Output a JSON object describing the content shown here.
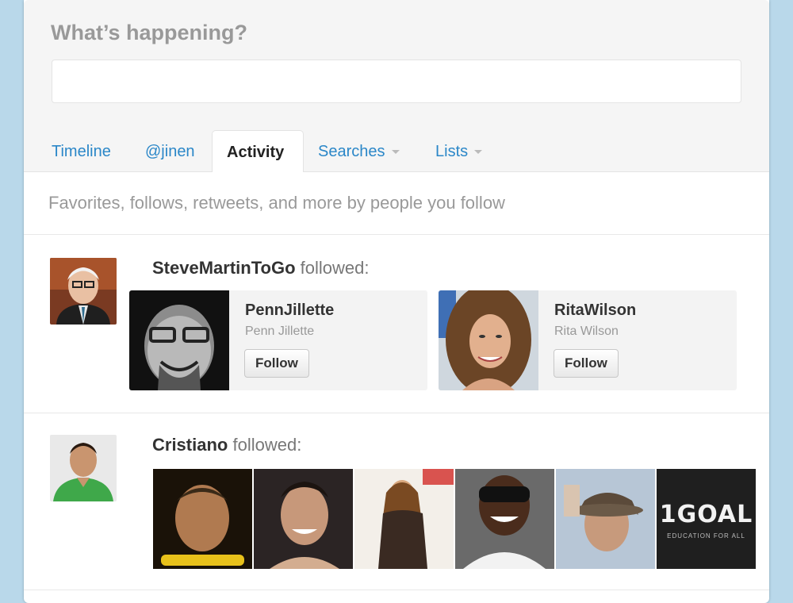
{
  "compose": {
    "title": "What’s happening?",
    "input_value": ""
  },
  "tabs": [
    {
      "label": "Timeline",
      "active": false
    },
    {
      "label": "@jinen",
      "active": false
    },
    {
      "label": "Activity",
      "active": true
    },
    {
      "label": "Searches",
      "active": false,
      "dropdown": true
    },
    {
      "label": "Lists",
      "active": false,
      "dropdown": true
    }
  ],
  "activity": {
    "subtitle": "Favorites, follows, retweets, and more by people you follow",
    "items": [
      {
        "actor": "SteveMartinToGo",
        "action": " followed:",
        "followed": [
          {
            "username": "PennJillette",
            "fullname": "Penn Jillette",
            "button": "Follow"
          },
          {
            "username": "RitaWilson",
            "fullname": "Rita Wilson",
            "button": "Follow"
          }
        ]
      },
      {
        "actor": "Cristiano",
        "action": " followed:",
        "thumbnails_count": 6,
        "last_thumb_text": "1GOAL",
        "last_thumb_subtext": "EDUCATION FOR ALL"
      }
    ]
  },
  "colors": {
    "background": "#b9d8ea",
    "link": "#2b87c8",
    "muted": "#999999"
  }
}
